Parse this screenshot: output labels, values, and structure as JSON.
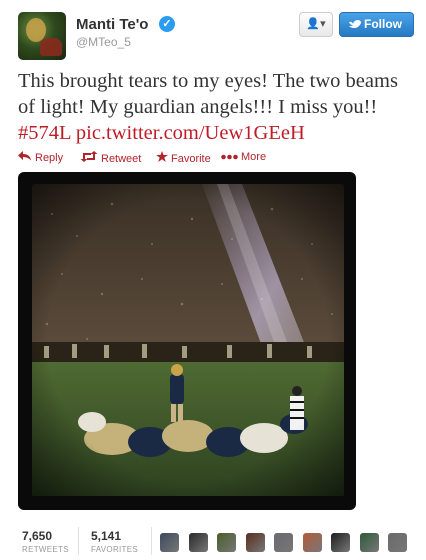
{
  "user": {
    "name": "Manti Te'o",
    "handle": "@MTeo_5",
    "verified_glyph": "✓"
  },
  "header": {
    "user_menu_icon": "▾",
    "follow_label": "Follow",
    "follow_icon": "twitter-bird-icon"
  },
  "tweet": {
    "text": "This brought tears to my eyes! The two beams of light! My guardian angels!!! I miss you!!",
    "hashtag": "#574L",
    "link": "pic.twitter.com/Uew1GEeH"
  },
  "actions": {
    "reply": "Reply",
    "retweet": "Retweet",
    "favorite": "Favorite",
    "more": "More"
  },
  "stats": {
    "retweets_count": "7,650",
    "retweets_label": "RETWEETS",
    "favorites_count": "5,141",
    "favorites_label": "FAVORITES"
  },
  "favoriters": [
    {
      "color": "#3a4a5e"
    },
    {
      "color": "#2a2a2a"
    },
    {
      "color": "#4a5e2a"
    },
    {
      "color": "#5a2e1e"
    },
    {
      "color": "#6a6a70"
    },
    {
      "color": "#b45a3a"
    },
    {
      "color": "#1e1e1e"
    },
    {
      "color": "#2e5a3a"
    },
    {
      "color": "#6a6a6a"
    }
  ]
}
